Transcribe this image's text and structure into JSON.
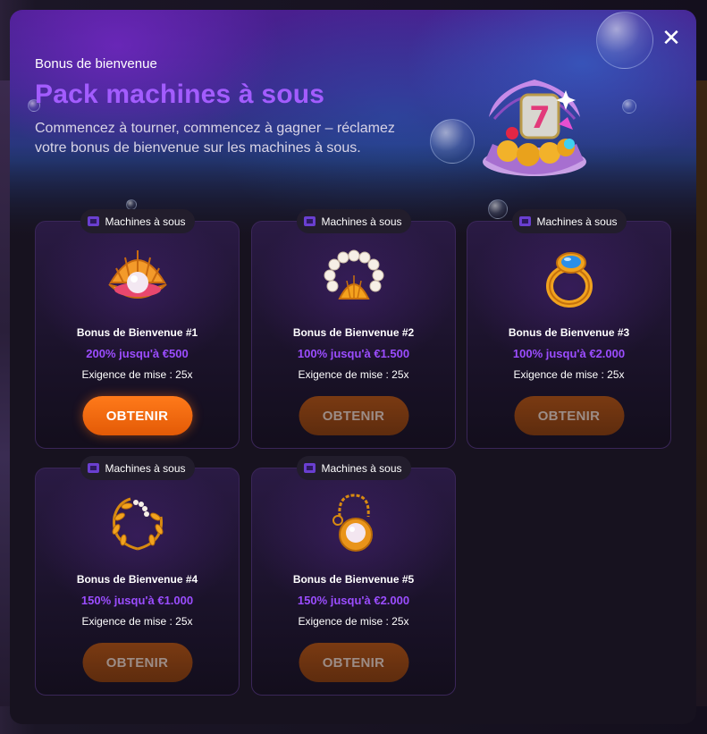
{
  "modal": {
    "eyebrow": "Bonus de bienvenue",
    "title": "Pack machines à sous",
    "subtitle": "Commencez à tourner, commencez à gagner – réclamez votre bonus de bienvenue sur les machines à sous.",
    "close_label": "✕"
  },
  "cards": [
    {
      "tag": "Machines à sous",
      "icon": "pearl-shell-icon",
      "name": "Bonus de Bienvenue #1",
      "offer": "200% jusqu'à €500",
      "requirement": "Exigence de mise : 25x",
      "button": "OBTENIR",
      "enabled": true
    },
    {
      "tag": "Machines à sous",
      "icon": "pearl-bracelet-icon",
      "name": "Bonus de Bienvenue #2",
      "offer": "100% jusqu'à €1.500",
      "requirement": "Exigence de mise : 25x",
      "button": "OBTENIR",
      "enabled": false
    },
    {
      "tag": "Machines à sous",
      "icon": "gem-ring-icon",
      "name": "Bonus de Bienvenue #3",
      "offer": "100% jusqu'à €2.000",
      "requirement": "Exigence de mise : 25x",
      "button": "OBTENIR",
      "enabled": false
    },
    {
      "tag": "Machines à sous",
      "icon": "laurel-wreath-icon",
      "name": "Bonus de Bienvenue #4",
      "offer": "150% jusqu'à €1.000",
      "requirement": "Exigence de mise : 25x",
      "button": "OBTENIR",
      "enabled": false
    },
    {
      "tag": "Machines à sous",
      "icon": "pearl-pendant-icon",
      "name": "Bonus de Bienvenue #5",
      "offer": "150% jusqu'à €2.000",
      "requirement": "Exigence de mise : 25x",
      "button": "OBTENIR",
      "enabled": false
    }
  ],
  "colors": {
    "title": "#a35cff",
    "offer": "#9b4dff",
    "button_active": "#f06a10",
    "button_disabled": "#6a3210"
  }
}
